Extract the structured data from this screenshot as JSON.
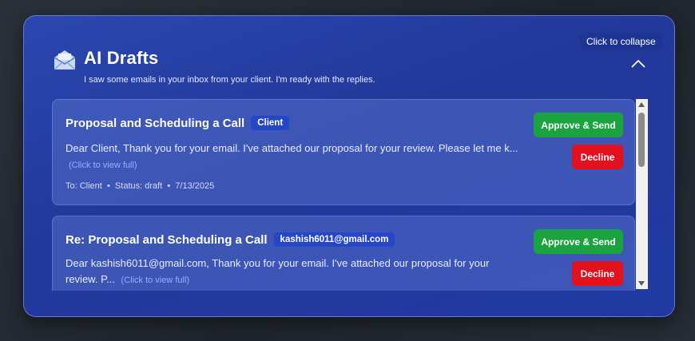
{
  "panel": {
    "title": "AI Drafts",
    "subtitle": "I saw some emails in your inbox from your client. I'm ready with the replies.",
    "tooltip": "Click to collapse"
  },
  "drafts": [
    {
      "subject": "Proposal and Scheduling a Call",
      "badge": "Client",
      "body_preview": "Dear Client, Thank you for your email. I've attached our proposal for your review. Please let me k...",
      "view_full": "(Click to view full)",
      "meta": "To: Client  •  Status: draft  •  7/13/2025",
      "approve_label": "Approve & Send",
      "decline_label": "Decline"
    },
    {
      "subject": "Re: Proposal and Scheduling a Call",
      "badge": "kashish6011@gmail.com",
      "body_preview": "Dear kashish6011@gmail.com, Thank you for your email. I've attached our proposal for your review. P...",
      "view_full": "(Click to view full)",
      "approve_label": "Approve & Send",
      "decline_label": "Decline"
    }
  ],
  "colors": {
    "panel_bg": "#22389a",
    "approve": "#1aa33e",
    "decline": "#e3101d",
    "badge": "#2547c7",
    "link": "#8fb4ff"
  },
  "icons": {
    "header": "envelope-open-icon",
    "collapse": "chevron-up-icon"
  }
}
